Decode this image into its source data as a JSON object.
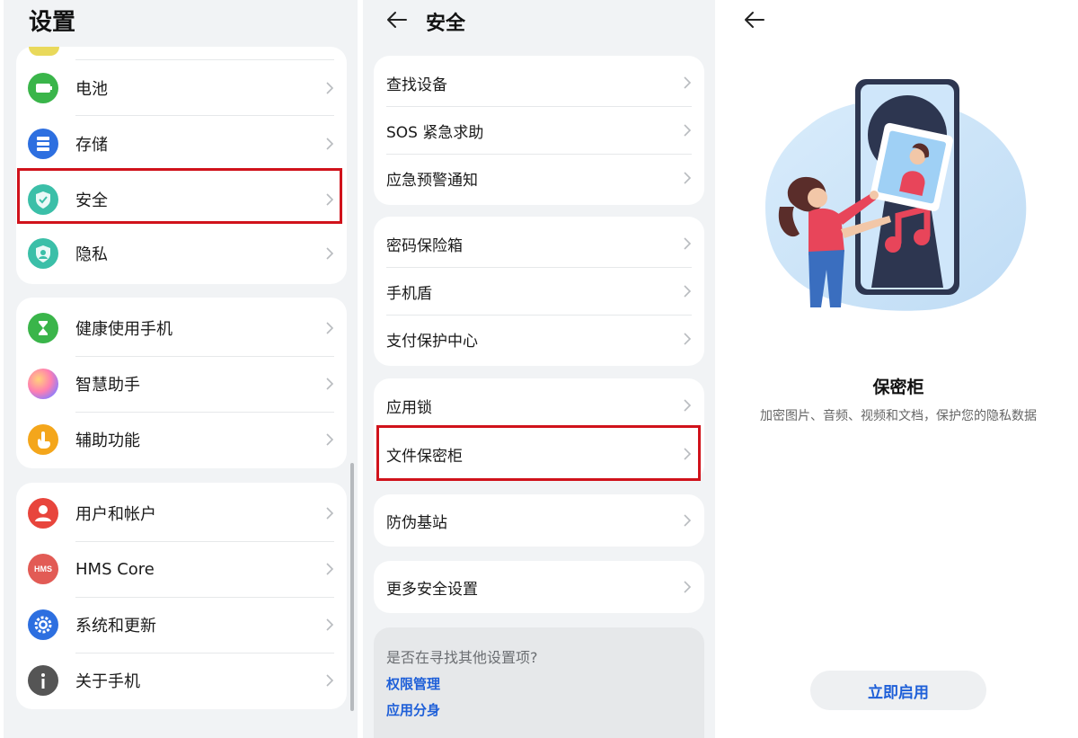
{
  "panel1": {
    "title": "设置",
    "group1": [
      {
        "label": "电池",
        "icon": "battery-icon",
        "color": "#3ab54a"
      },
      {
        "label": "存储",
        "icon": "storage-icon",
        "color": "#2d6fe0"
      },
      {
        "label": "安全",
        "icon": "shield-icon",
        "color": "#3bbfa8"
      },
      {
        "label": "隐私",
        "icon": "privacy-icon",
        "color": "#3bbfa8"
      }
    ],
    "group2": [
      {
        "label": "健康使用手机",
        "icon": "hourglass-icon",
        "color": "#3ab54a"
      },
      {
        "label": "智慧助手",
        "icon": "assistant-icon",
        "color": "#b45cff"
      },
      {
        "label": "辅助功能",
        "icon": "hand-icon",
        "color": "#f4a61b"
      }
    ],
    "group3": [
      {
        "label": "用户和帐户",
        "icon": "user-icon",
        "color": "#e8453c"
      },
      {
        "label": "HMS Core",
        "icon": "hms-icon",
        "color": "#e25b55",
        "badge": "HMS"
      },
      {
        "label": "系统和更新",
        "icon": "gear-icon",
        "color": "#2d6fe0"
      },
      {
        "label": "关于手机",
        "icon": "info-icon",
        "color": "#555555"
      }
    ]
  },
  "panel2": {
    "title": "安全",
    "group1": [
      "查找设备",
      "SOS 紧急求助",
      "应急预警通知"
    ],
    "group2": [
      "密码保险箱",
      "手机盾",
      "支付保护中心"
    ],
    "group3": [
      "应用锁",
      "文件保密柜"
    ],
    "group4": [
      "防伪基站"
    ],
    "group5": [
      "更多安全设置"
    ],
    "suggest": {
      "question": "是否在寻找其他设置项?",
      "links": [
        "权限管理",
        "应用分身"
      ]
    }
  },
  "panel3": {
    "feature_title": "保密柜",
    "feature_desc": "加密图片、音频、视频和文档，保护您的隐私数据",
    "enable_label": "立即启用"
  },
  "colors": {
    "accent": "#1e5fd8",
    "highlight": "#d0121b"
  }
}
